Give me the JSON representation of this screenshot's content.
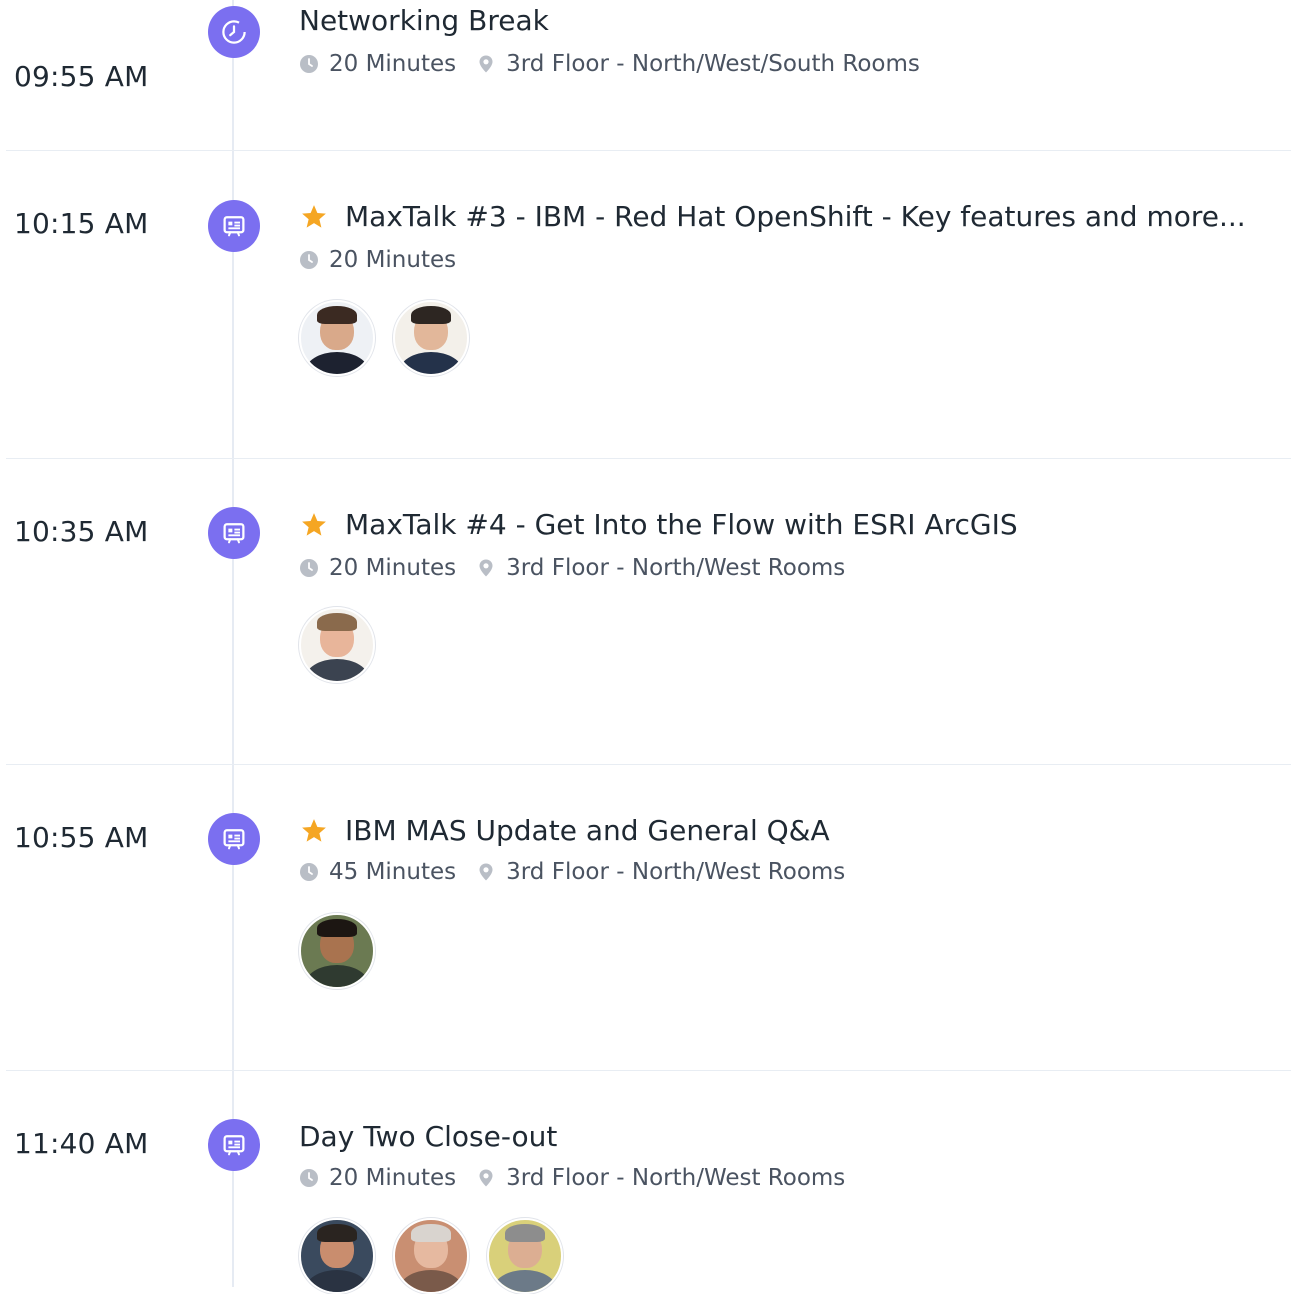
{
  "sessions": [
    {
      "time": "09:55 AM",
      "type_icon": "clock-icon",
      "starred": false,
      "title": "Networking Break",
      "duration": "20 Minutes",
      "location": "3rd Floor - North/West/South Rooms",
      "speakers": []
    },
    {
      "time": "10:15 AM",
      "type_icon": "presentation-icon",
      "starred": true,
      "title": "MaxTalk #3 - IBM - Red Hat OpenShift - Key features and more...",
      "duration": "20 Minutes",
      "location": "",
      "speakers": [
        {
          "icon": "speaker-avatar",
          "skin": "#d9a98a",
          "hair": "#3b2a22",
          "bg": "#eef1f5",
          "shirt": "#1d2230"
        },
        {
          "icon": "speaker-avatar",
          "skin": "#e2b79a",
          "hair": "#2d2622",
          "bg": "#f3f0ea",
          "shirt": "#24324a"
        }
      ]
    },
    {
      "time": "10:35 AM",
      "type_icon": "presentation-icon",
      "starred": true,
      "title": "MaxTalk #4 - Get Into the Flow with ESRI ArcGIS",
      "duration": "20 Minutes",
      "location": "3rd Floor - North/West Rooms",
      "speakers": [
        {
          "icon": "speaker-avatar",
          "skin": "#e8b59a",
          "hair": "#8a6a4c",
          "bg": "#f4f1ec",
          "shirt": "#3b4350"
        }
      ]
    },
    {
      "time": "10:55 AM",
      "type_icon": "presentation-icon",
      "starred": true,
      "title": "IBM MAS Update and General Q&A",
      "duration": "45 Minutes",
      "location": "3rd Floor - North/West Rooms",
      "speakers": [
        {
          "icon": "speaker-avatar",
          "skin": "#a9734f",
          "hair": "#1c1612",
          "bg": "#6b7a52",
          "shirt": "#2f3a30"
        }
      ]
    },
    {
      "time": "11:40 AM",
      "type_icon": "presentation-icon",
      "starred": false,
      "title": "Day Two Close-out",
      "duration": "20 Minutes",
      "location": "3rd Floor - North/West Rooms",
      "speakers": [
        {
          "icon": "speaker-avatar",
          "skin": "#c98d6e",
          "hair": "#2a2420",
          "bg": "#3a4a5e",
          "shirt": "#2a3342"
        },
        {
          "icon": "speaker-avatar",
          "skin": "#e6b9a0",
          "hair": "#d9d4cf",
          "bg": "#c98f72",
          "shirt": "#7a5a4a"
        },
        {
          "icon": "speaker-avatar",
          "skin": "#dcae92",
          "hair": "#8d8d8d",
          "bg": "#d9d07a",
          "shirt": "#6c7a88"
        }
      ]
    }
  ],
  "colors": {
    "node": "#7b6ff0",
    "star": "#f5a623",
    "meta_icon": "#b9bec6",
    "divider": "#e8edf3",
    "timeline": "#e6ebf3"
  }
}
